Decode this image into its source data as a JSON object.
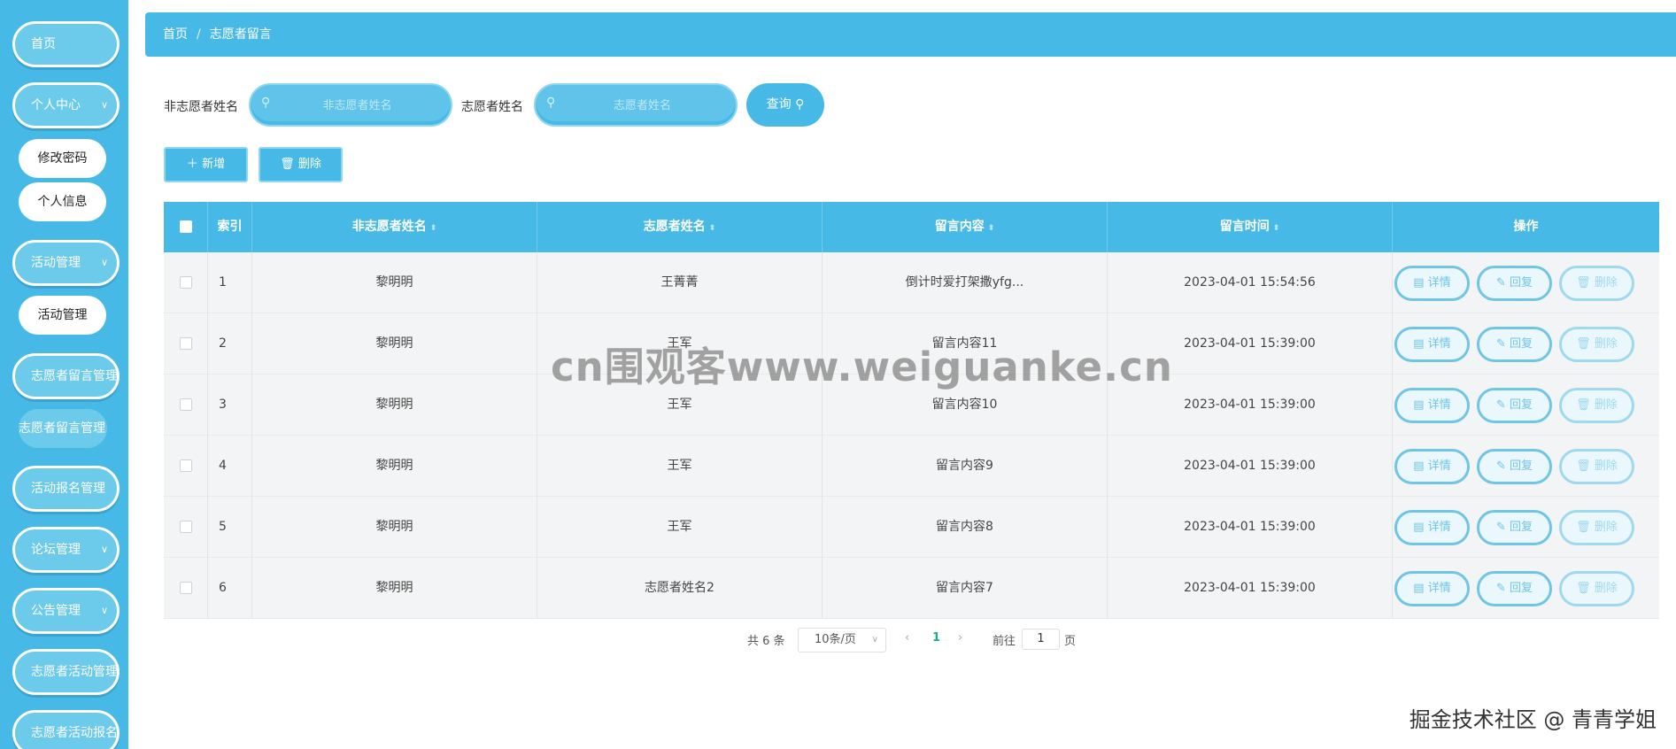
{
  "sidebar": {
    "home": "首页",
    "personal_center": "个人中心",
    "change_password": "修改密码",
    "personal_info": "个人信息",
    "activity_mgmt": "活动管理",
    "activity_mgmt_sub": "活动管理",
    "volunteer_msg_mgmt": "志愿者留言管理",
    "volunteer_msg_mgmt_sub": "志愿者留言管理",
    "activity_signup_mgmt": "活动报名管理",
    "forum_mgmt": "论坛管理",
    "notice_mgmt": "公告管理",
    "volunteer_activity_mgmt": "志愿者活动管理",
    "volunteer_activity_signup": "志愿者活动报名管"
  },
  "breadcrumb": {
    "home": "首页",
    "separator": "/",
    "current": "志愿者留言"
  },
  "search": {
    "label_non_volunteer": "非志愿者姓名",
    "placeholder_non_volunteer": "非志愿者姓名",
    "label_volunteer": "志愿者姓名",
    "placeholder_volunteer": "志愿者姓名",
    "query_label": "查询"
  },
  "actions": {
    "add_label": "新增",
    "delete_label": "删除"
  },
  "table": {
    "headers": [
      "索引",
      "非志愿者姓名",
      "志愿者姓名",
      "留言内容",
      "留言时间",
      "操作"
    ],
    "rows": [
      {
        "index": "1",
        "non_volunteer": "黎明明",
        "volunteer": "王菁菁",
        "content": "倒计时爱打架撒yfg...",
        "time": "2023-04-01 15:54:56"
      },
      {
        "index": "2",
        "non_volunteer": "黎明明",
        "volunteer": "王军",
        "content": "留言内容11",
        "time": "2023-04-01 15:39:00"
      },
      {
        "index": "3",
        "non_volunteer": "黎明明",
        "volunteer": "王军",
        "content": "留言内容10",
        "time": "2023-04-01 15:39:00"
      },
      {
        "index": "4",
        "non_volunteer": "黎明明",
        "volunteer": "王军",
        "content": "留言内容9",
        "time": "2023-04-01 15:39:00"
      },
      {
        "index": "5",
        "non_volunteer": "黎明明",
        "volunteer": "王军",
        "content": "留言内容8",
        "time": "2023-04-01 15:39:00"
      },
      {
        "index": "6",
        "non_volunteer": "黎明明",
        "volunteer": "志愿者姓名2",
        "content": "留言内容7",
        "time": "2023-04-01 15:39:00"
      }
    ],
    "row_actions": {
      "detail": "详情",
      "reply": "回复",
      "delete": "删除"
    }
  },
  "pagination": {
    "total": "共 6 条",
    "page_size": "10条/页",
    "current_page": "1",
    "goto_prefix": "前往",
    "goto_value": "1",
    "goto_suffix": "页"
  },
  "watermark": "cn围观客www.weiguanke.cn",
  "credit": "掘金技术社区 @ 青青学姐",
  "colors": {
    "primary": "#47b9e6",
    "light": "#6ccaea",
    "row_bg": "#f3f4f5",
    "active_page": "#1aad8c"
  },
  "icons": [
    "search-icon",
    "plus-icon",
    "trash-icon",
    "doc-icon",
    "edit-icon",
    "chevron-down-icon",
    "chevron-left-icon",
    "chevron-right-icon",
    "sort-icon"
  ]
}
